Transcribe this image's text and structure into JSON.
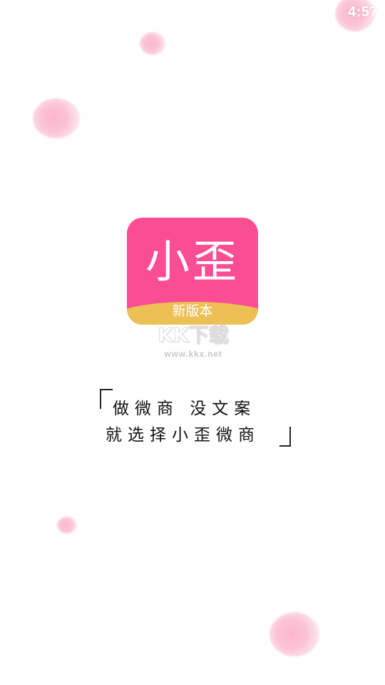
{
  "status_bar": {
    "time": "4:57"
  },
  "app_logo": {
    "name": "小歪",
    "version_badge": "新版本",
    "colors": {
      "primary": "#fb4d93",
      "band": "#ecc055",
      "bubble": "#fbb6cc"
    }
  },
  "watermark": {
    "logo_text": "KK下载",
    "url": "www.kkx.net"
  },
  "slogan": {
    "line1": "做微商 没文案",
    "line2": "就选择小歪微商"
  }
}
